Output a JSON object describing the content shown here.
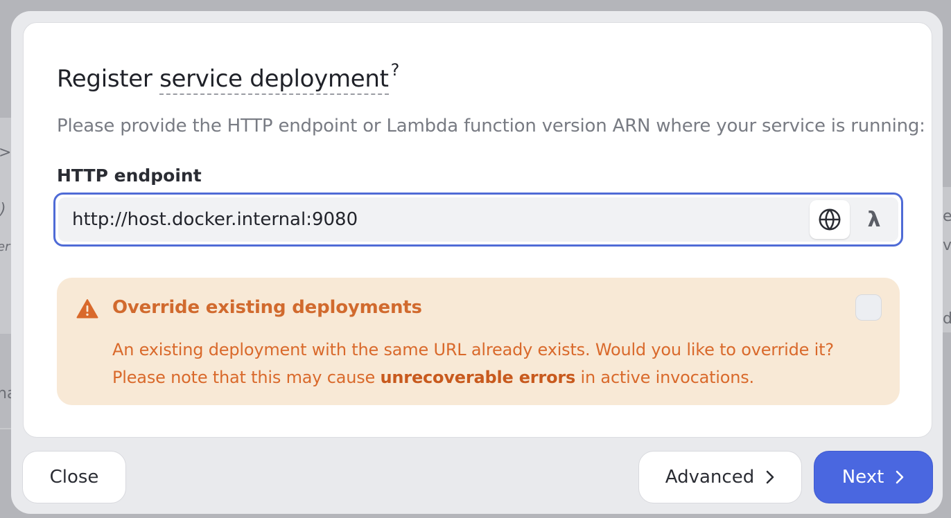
{
  "dialog": {
    "title_main": "Register ",
    "title_dotted": "service deployment",
    "title_help": "?",
    "subtitle": "Please provide the HTTP endpoint or Lambda function version ARN where your service is running:"
  },
  "endpoint": {
    "label": "HTTP endpoint",
    "value": "http://host.docker.internal:9080",
    "globe_icon": "globe-icon",
    "lambda_icon": "lambda-icon",
    "lambda_glyph": "λ"
  },
  "alert": {
    "icon": "warning-icon",
    "title": "Override existing deployments",
    "line1": "An existing deployment with the same URL already exists. Would you like to override it?",
    "line2_before": "Please note that this may cause ",
    "line2_bold": "unrecoverable errors",
    "line2_after": " in active invocations.",
    "checked": false,
    "color": "#d9692b",
    "background": "#f8e9d6"
  },
  "footer": {
    "close_label": "Close",
    "advanced_label": "Advanced",
    "next_label": "Next",
    "accent_color": "#4a67e0"
  },
  "background": {
    "left_glyphs": [
      ">",
      ")",
      "er",
      "na"
    ],
    "right_glyphs": [
      "e",
      "v",
      "d"
    ]
  }
}
